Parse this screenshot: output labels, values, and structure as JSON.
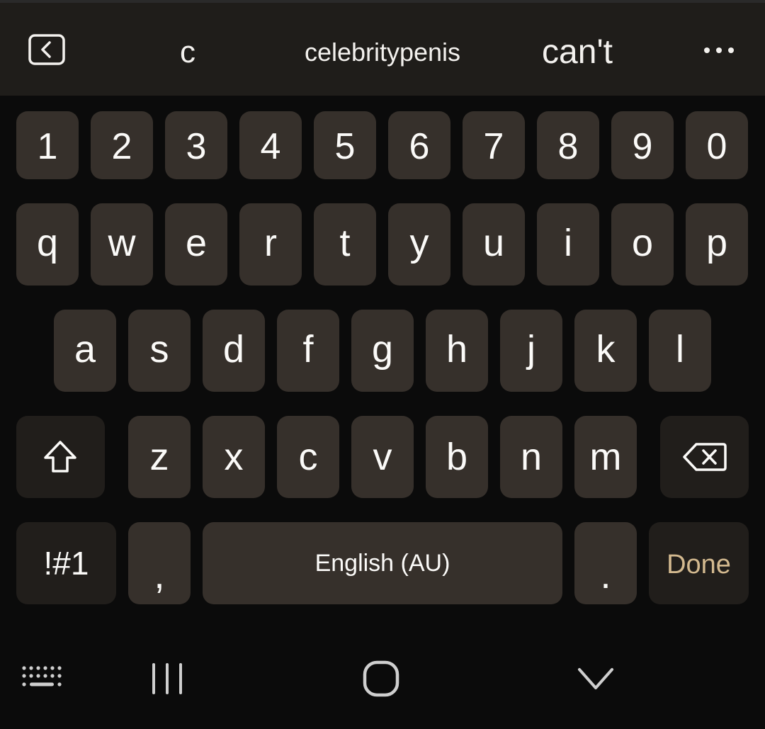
{
  "suggestions": [
    "c",
    "celebritypenis",
    "can't"
  ],
  "number_row": [
    "1",
    "2",
    "3",
    "4",
    "5",
    "6",
    "7",
    "8",
    "9",
    "0"
  ],
  "row_q": [
    "q",
    "w",
    "e",
    "r",
    "t",
    "y",
    "u",
    "i",
    "o",
    "p"
  ],
  "row_a": [
    "a",
    "s",
    "d",
    "f",
    "g",
    "h",
    "j",
    "k",
    "l"
  ],
  "row_z": [
    "z",
    "x",
    "c",
    "v",
    "b",
    "n",
    "m"
  ],
  "bottom": {
    "symbols": "!#1",
    "comma": ",",
    "space": "English (AU)",
    "period": ".",
    "done": "Done"
  },
  "colors": {
    "background": "#0b0b0b",
    "suggestion_bar": "#1f1d1a",
    "key": "#36302b",
    "function_key": "#211e1b",
    "done_text": "#d3b98f"
  },
  "icons": {
    "back": "chevron-left-box-icon",
    "more": "more-horizontal-icon",
    "shift": "shift-arrow-icon",
    "backspace": "backspace-icon",
    "keyboard": "keyboard-icon",
    "recents": "recent-apps-icon",
    "home": "home-icon",
    "hide": "chevron-down-icon"
  }
}
